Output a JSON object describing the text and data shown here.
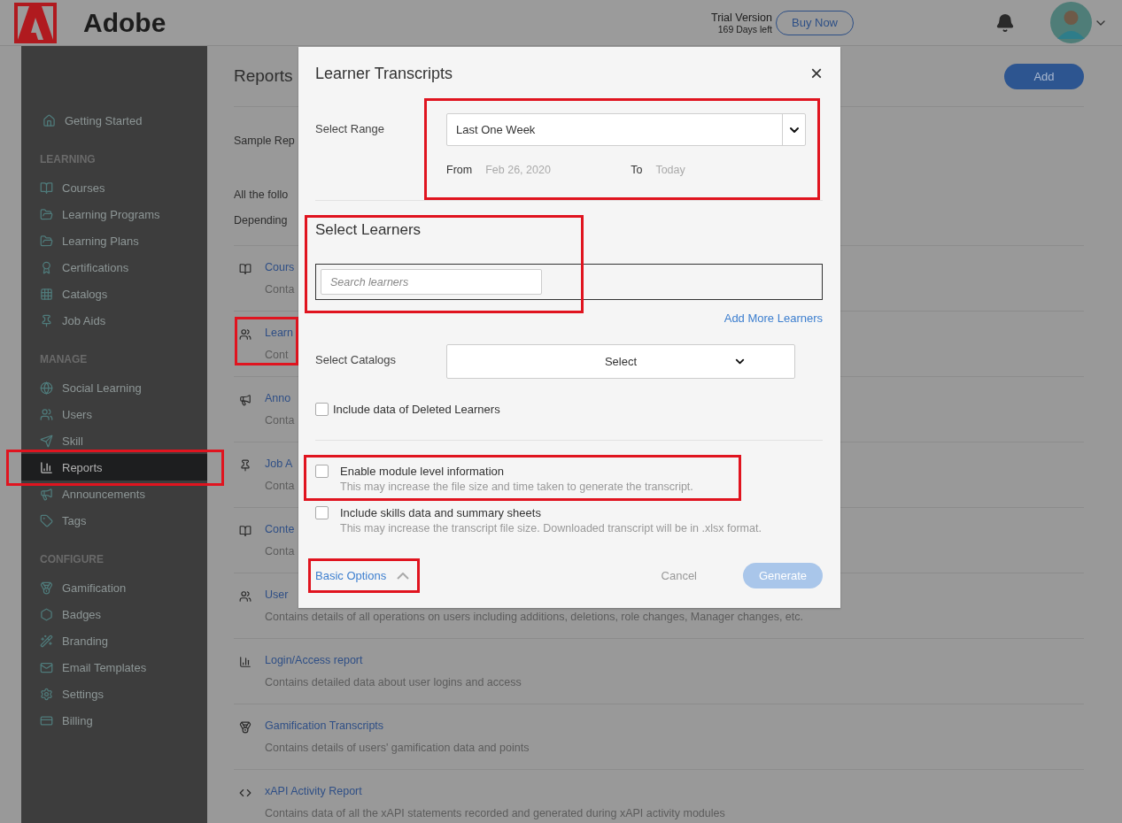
{
  "header": {
    "logo_text": "Adobe",
    "trial_label": "Trial Version",
    "days_left": "169 Days left",
    "buy_button": "Buy Now"
  },
  "sidebar": {
    "sections": [
      {
        "items": [
          {
            "label": "Getting Started",
            "selected": false,
            "highlighted": false
          }
        ]
      },
      {
        "title": "LEARNING",
        "items": [
          {
            "label": "Courses",
            "selected": false,
            "highlighted": false
          },
          {
            "label": "Learning Programs",
            "selected": false,
            "highlighted": false
          },
          {
            "label": "Learning Plans",
            "selected": false,
            "highlighted": false
          },
          {
            "label": "Certifications",
            "selected": false,
            "highlighted": false
          },
          {
            "label": "Catalogs",
            "selected": false,
            "highlighted": false
          },
          {
            "label": "Job Aids",
            "selected": false,
            "highlighted": false
          }
        ]
      },
      {
        "title": "MANAGE",
        "items": [
          {
            "label": "Social Learning",
            "selected": false,
            "highlighted": false
          },
          {
            "label": "Users",
            "selected": false,
            "highlighted": false
          },
          {
            "label": "Skill",
            "selected": false,
            "highlighted": false
          },
          {
            "label": "Reports",
            "selected": true,
            "highlighted": true
          },
          {
            "label": "Announcements",
            "selected": false,
            "highlighted": false
          },
          {
            "label": "Tags",
            "selected": false,
            "highlighted": false
          }
        ]
      },
      {
        "title": "CONFIGURE",
        "items": [
          {
            "label": "Gamification",
            "selected": false,
            "highlighted": false
          },
          {
            "label": "Badges",
            "selected": false,
            "highlighted": false
          },
          {
            "label": "Branding",
            "selected": false,
            "highlighted": false
          },
          {
            "label": "Email Templates",
            "selected": false,
            "highlighted": false
          },
          {
            "label": "Settings",
            "selected": false,
            "highlighted": false
          },
          {
            "label": "Billing",
            "selected": false,
            "highlighted": false
          }
        ]
      }
    ]
  },
  "page": {
    "title": "Reports",
    "add_button": "Add",
    "intro": "Sample Rep",
    "notes": [
      "All the follo",
      "Depending"
    ],
    "reports": [
      {
        "title": "Cours",
        "description": "Conta",
        "highlighted": false
      },
      {
        "title": "Learn",
        "description": "Cont",
        "highlighted": true
      },
      {
        "title": "Anno",
        "description": "Conta",
        "highlighted": false
      },
      {
        "title": "Job A",
        "description": "Conta",
        "highlighted": false
      },
      {
        "title": "Conte",
        "description": "Conta",
        "highlighted": false
      },
      {
        "title": "User",
        "description": "Contains details of all operations on users including additions, deletions, role changes, Manager changes, etc.",
        "highlighted": false
      },
      {
        "title": "Login/Access report",
        "description": "Contains detailed data about user logins and access",
        "highlighted": false
      },
      {
        "title": "Gamification Transcripts",
        "description": "Contains details of users' gamification data and points",
        "highlighted": false
      },
      {
        "title": "xAPI Activity Report",
        "description": "Contains data of all the xAPI statements recorded and generated during xAPI activity modules",
        "highlighted": false
      }
    ]
  },
  "dialog": {
    "title": "Learner Transcripts",
    "close": "×",
    "range": {
      "label": "Select Range",
      "value": "Last One Week",
      "from_label": "From",
      "from_value": "Feb 26, 2020",
      "to_label": "To",
      "to_value": "Today",
      "highlighted": true
    },
    "learners": {
      "heading": "Select Learners",
      "placeholder": "Search learners",
      "highlighted": true,
      "add_more": "Add More Learners"
    },
    "catalogs": {
      "label": "Select Catalogs",
      "value": "Select"
    },
    "deleted_learners": {
      "label": "Include data of Deleted Learners",
      "checked": false
    },
    "options": [
      {
        "label": "Enable module level information",
        "hint": "This may increase the file size and time taken to generate the transcript.",
        "checked": false,
        "highlighted": true
      },
      {
        "label": "Include skills data and summary sheets",
        "hint": "This may increase the transcript file size. Downloaded transcript will be in .xlsx format.",
        "checked": false,
        "highlighted": false
      }
    ],
    "basic_options": {
      "label": "Basic Options",
      "expanded": true,
      "highlighted": true
    },
    "cancel": "Cancel",
    "generate": {
      "label": "Generate",
      "disabled": true
    }
  }
}
